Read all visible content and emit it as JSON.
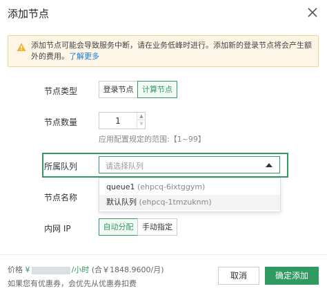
{
  "dialog": {
    "title": "添加节点"
  },
  "alert": {
    "text": "添加节点可能会导致服务中断，请在业务低峰时进行。添加新的登录节点将会产生额外的费用。",
    "link": "了解更多",
    "color": "#f2b632"
  },
  "form": {
    "node_type": {
      "label": "节点类型",
      "options": [
        "登录节点",
        "计算节点"
      ],
      "selected": "计算节点"
    },
    "node_count": {
      "label": "节点数量",
      "value": "1",
      "hint": "应用配置规定的范围:【1~99】"
    },
    "queue": {
      "label": "所属队列",
      "placeholder": "请选择队列",
      "options": [
        {
          "name": "queue1",
          "id": "(ehpcq-6ixtggym)"
        },
        {
          "name": "默认队列",
          "id": "(ehpcq-1tmzuknm)"
        }
      ]
    },
    "node_name": {
      "label": "节点名称"
    },
    "ip": {
      "label": "内网 IP",
      "options": [
        "自动分配",
        "手动指定"
      ],
      "selected": "自动分配"
    }
  },
  "footer": {
    "price_label": "价格",
    "price_prefix": "¥",
    "price_unit": "/小时",
    "price_monthly": "(合￥1848.9600/月)",
    "note": "如果您有优惠券，会优先从优惠券扣费",
    "cancel": "取消",
    "confirm": "确定添加"
  },
  "colors": {
    "accent": "#2f9a60",
    "link": "#1a7bd6"
  }
}
